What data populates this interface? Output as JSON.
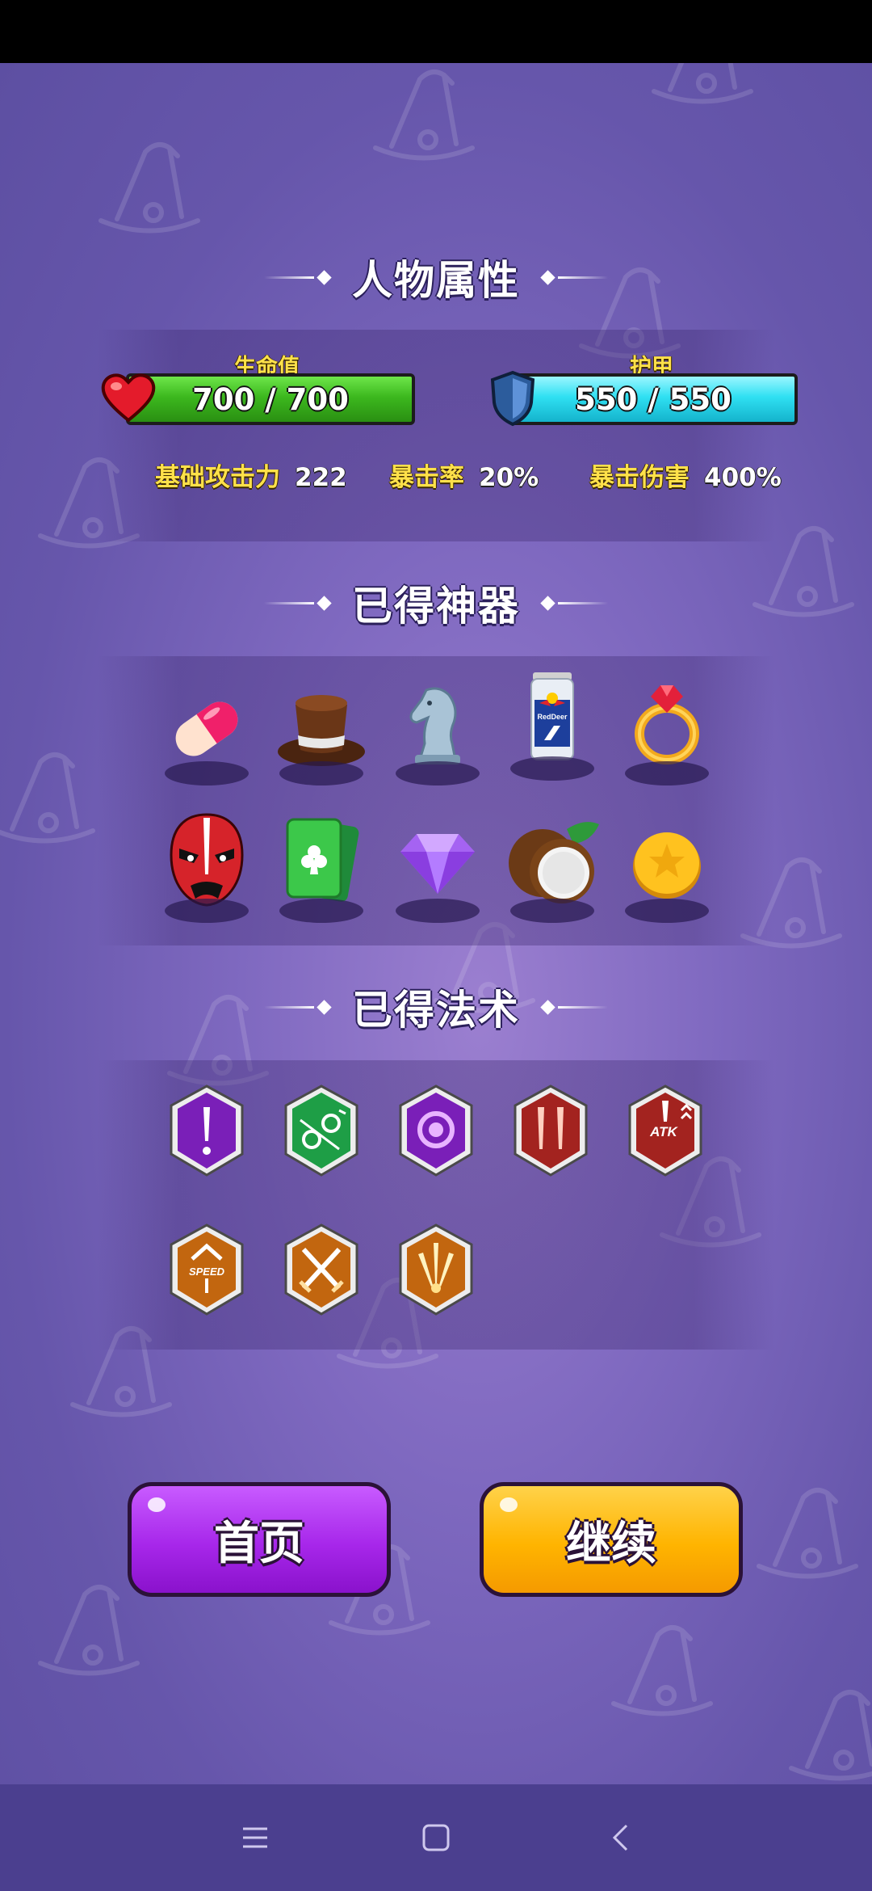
{
  "sections": {
    "attributes_title": "人物属性",
    "artifacts_title": "已得神器",
    "spells_title": "已得法术"
  },
  "hp": {
    "label": "生命值",
    "value": "700 / 700",
    "fill": 1.0
  },
  "armor": {
    "label": "护甲",
    "value": "550 / 550",
    "fill": 1.0
  },
  "stats": [
    {
      "key": "基础攻击力",
      "value": "222"
    },
    {
      "key": "暴击率",
      "value": "20%"
    },
    {
      "key": "暴击伤害",
      "value": "400%"
    }
  ],
  "artifacts": [
    "pill",
    "top-hat",
    "chess-knight",
    "energy-drink",
    "ruby-ring",
    "opera-mask",
    "club-card",
    "diamond",
    "coconut",
    "gold-coin"
  ],
  "energy_drink_text": "RedDeer",
  "spells": [
    "exclamation",
    "green-links",
    "purple-orb",
    "twin-claws",
    "atk-boost",
    "speed-boost",
    "crossed-swords",
    "triple-burst"
  ],
  "spell_texts": {
    "atk": "ATK",
    "speed": "SPEED"
  },
  "buttons": {
    "home": "首页",
    "continue": "继续"
  },
  "colors": {
    "hp": "#3cb81e",
    "armor": "#2fe0f2",
    "home_button": "#a727ea",
    "continue_button": "#ffb400",
    "label": "#ffe14a"
  }
}
